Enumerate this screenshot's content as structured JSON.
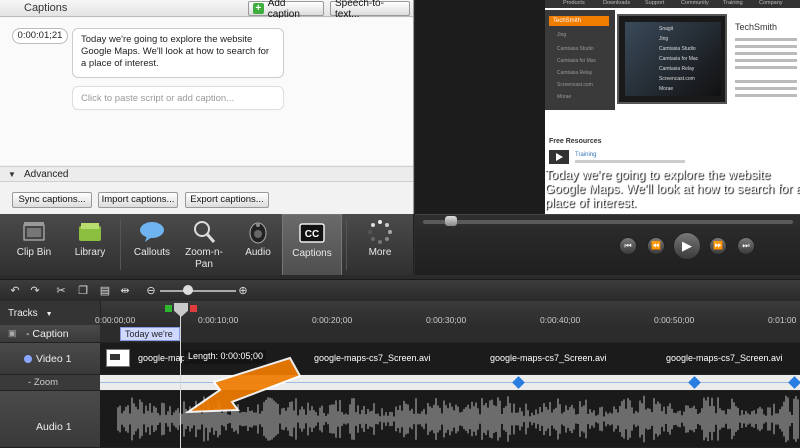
{
  "captions_panel": {
    "title": "Captions",
    "add_caption_label": "Add caption",
    "speech_to_text_label": "Speech-to-text...",
    "timestamp": "0:00:01;21",
    "caption_text": "Today we're going to explore the website Google Maps.  We'll look at how to search for a place of interest.",
    "paste_placeholder": "Click to paste script or add caption...",
    "advanced_label": "Advanced",
    "sync_label": "Sync captions...",
    "import_label": "Import captions...",
    "export_label": "Export captions..."
  },
  "tools": [
    {
      "label": "Clip Bin",
      "icon": "film-icon"
    },
    {
      "label": "Library",
      "icon": "library-icon"
    },
    {
      "label": "Callouts",
      "icon": "callout-bubble-icon"
    },
    {
      "label": "Zoom-n-\nPan",
      "icon": "zoom-magnifier-icon"
    },
    {
      "label": "Audio",
      "icon": "speaker-icon"
    },
    {
      "label": "Captions",
      "icon": "cc-icon"
    },
    {
      "label": "More",
      "icon": "more-dots-icon"
    }
  ],
  "preview": {
    "nav_items": [
      "Products",
      "Downloads",
      "Support",
      "Community",
      "Training",
      "Company"
    ],
    "side_highlight": "TechSmith",
    "side_items": [
      "Jing",
      "Camtasia Studio",
      "Camtasia for Mac",
      "Camtasia Relay",
      "Screencast.com",
      "Morae"
    ],
    "monitor_items": [
      "Snagit",
      "Jing",
      "Camtasia Studio",
      "Camtasia for Mac",
      "Camtasia Relay",
      "Screencast.com",
      "Morae"
    ],
    "logo": "TechSmith",
    "free_resources": "Free Resources",
    "training_text": "Training",
    "overlay_caption": "Today we're going to explore the website Google Maps.  We'll look at how to search for a place of interest."
  },
  "player": {
    "prev_label": "⏮",
    "rewind_label": "⏪",
    "play_label": "▶",
    "forward_label": "⏩",
    "next_label": "⏭"
  },
  "timeline": {
    "tracks_label": "Tracks",
    "ticks": [
      "0:00:00;00",
      "0:00:10;00",
      "0:00:20;00",
      "0:00:30;00",
      "0:00:40;00",
      "0:00:50;00",
      "0:01:00"
    ],
    "caption_track": "Caption",
    "caption_clip": "Today we're",
    "video_track": "Video 1",
    "zoom_track": "Zoom",
    "audio_track": "Audio 1",
    "video_clips": [
      "google-maps",
      "google-maps-cs7_Screen.avi",
      "google-maps-cs7_Screen.avi",
      "google-maps-cs7_Screen.avi"
    ],
    "length_tip": "Length:  0:00:05;00"
  },
  "colors": {
    "accent_orange": "#f07c00",
    "zoom_diamond": "#2a7de0",
    "caption_clip": "#cfd8ff"
  }
}
